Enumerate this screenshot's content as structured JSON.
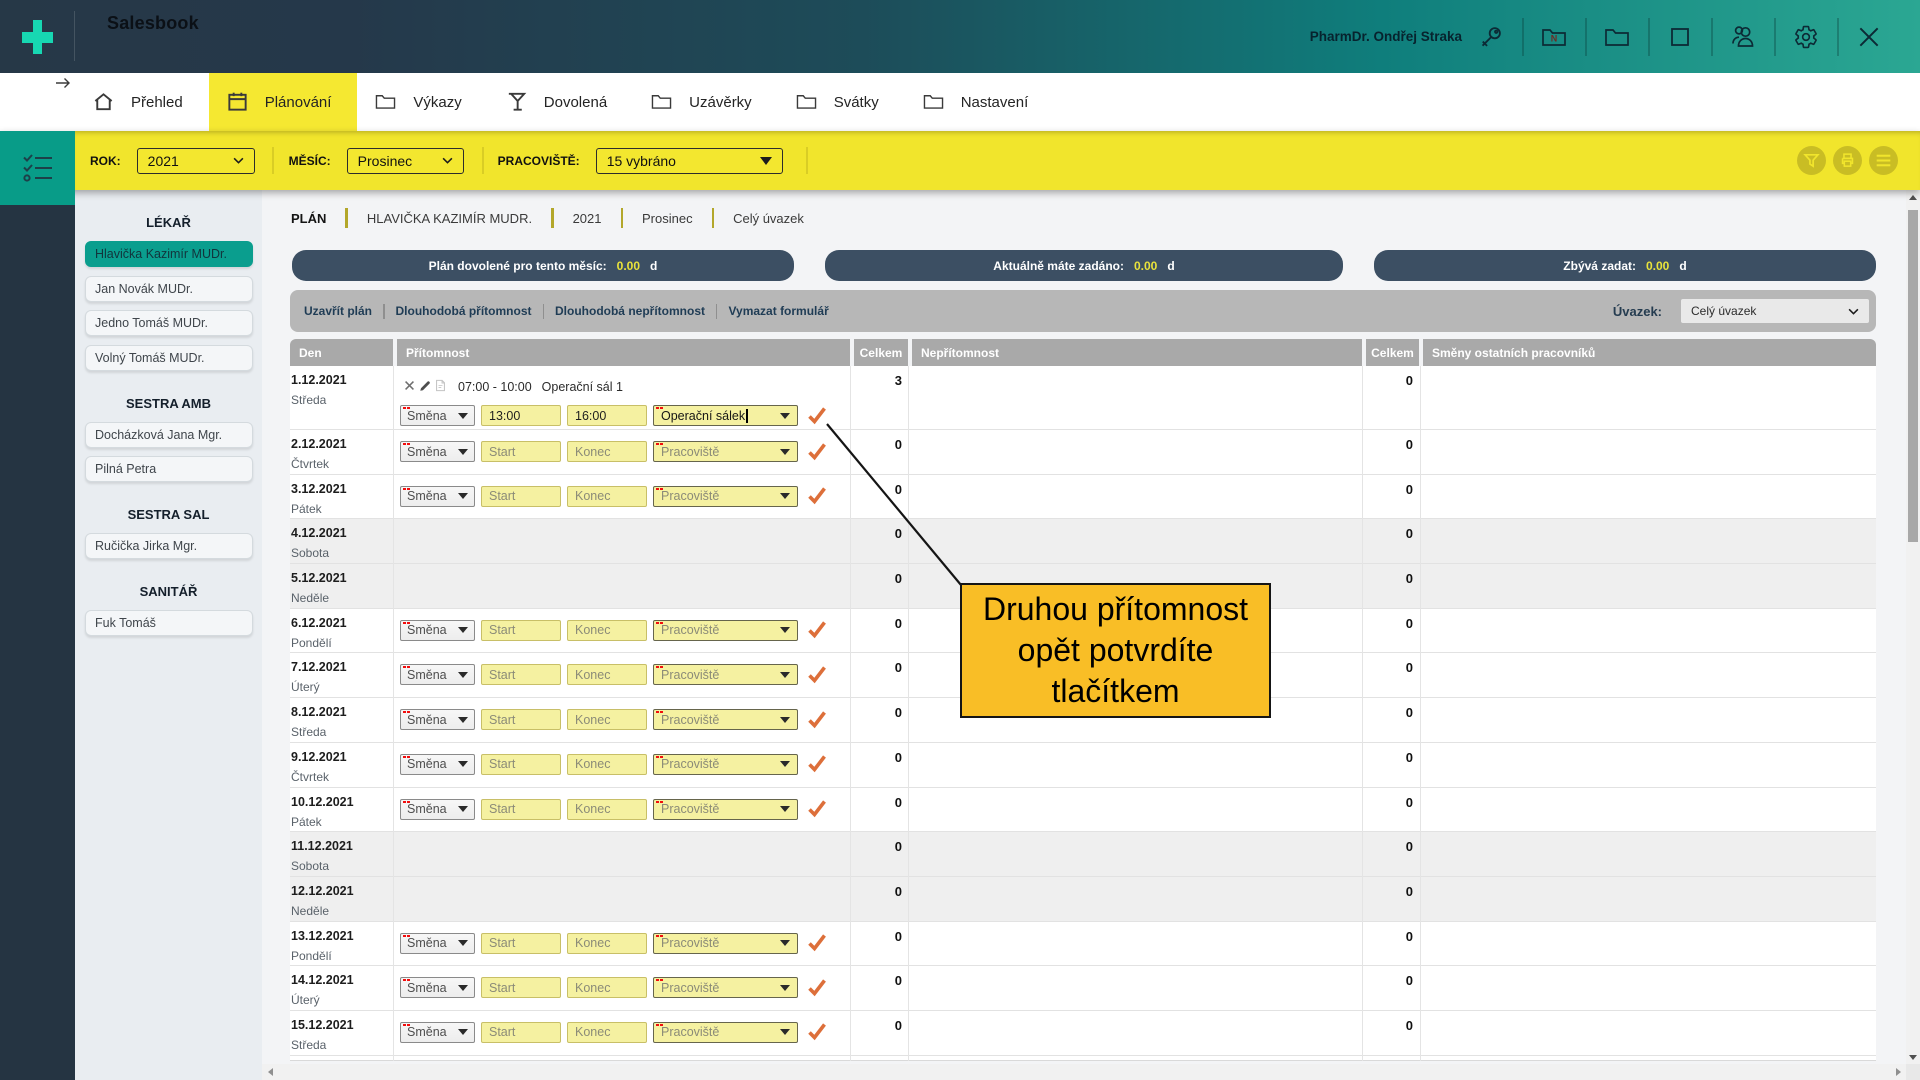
{
  "header": {
    "app_title": "Salesbook",
    "user_name": "PharmDr. Ondřej Straka",
    "icon_buttons": [
      "key",
      "folder-new",
      "folder",
      "stop-square",
      "users",
      "settings-gear",
      "close-x"
    ]
  },
  "nav": {
    "back_arrow": "→",
    "tabs": [
      {
        "label": "Přehled",
        "icon": "home",
        "active": false
      },
      {
        "label": "Plánování",
        "icon": "calendar",
        "active": true
      },
      {
        "label": "Výkazy",
        "icon": "folder",
        "active": false
      },
      {
        "label": "Dovolená",
        "icon": "martini",
        "active": false
      },
      {
        "label": "Uzávěrky",
        "icon": "folder",
        "active": false
      },
      {
        "label": "Svátky",
        "icon": "folder",
        "active": false
      },
      {
        "label": "Nastavení",
        "icon": "folder",
        "active": false
      }
    ]
  },
  "filter_bar": {
    "fields": [
      {
        "label": "ROK:",
        "value": "2021",
        "arrow": "chevron"
      },
      {
        "label": "MĚSÍC:",
        "value": "Prosinec",
        "arrow": "chevron"
      },
      {
        "label": "PRACOVIŠTĚ:",
        "value": "15 vybráno",
        "arrow": "triangle"
      }
    ],
    "action_icons": [
      "filter-funnel",
      "printer",
      "menu-lines"
    ]
  },
  "sidebar": {
    "groups": [
      {
        "title": "LÉKAŘ",
        "people": [
          {
            "name": "Hlavička Kazimír MUDr.",
            "selected": true
          },
          {
            "name": "Jan Novák MUDr.",
            "selected": false
          },
          {
            "name": "Jedno Tomáš MUDr.",
            "selected": false
          },
          {
            "name": "Volný Tomáš MUDr.",
            "selected": false
          }
        ]
      },
      {
        "title": "SESTRA AMB",
        "people": [
          {
            "name": "Docházková Jana Mgr.",
            "selected": false
          },
          {
            "name": "Pilná Petra",
            "selected": false
          }
        ]
      },
      {
        "title": "SESTRA SAL",
        "people": [
          {
            "name": "Ručička Jirka Mgr.",
            "selected": false
          }
        ]
      },
      {
        "title": "SANITÁŘ",
        "people": [
          {
            "name": "Fuk Tomáš",
            "selected": false
          }
        ]
      }
    ]
  },
  "breadcrumb": [
    "PLÁN",
    "HLAVIČKA KAZIMÍR MUDR.",
    "2021",
    "Prosinec",
    "Celý úvazek"
  ],
  "summary_bars": [
    {
      "label": "Plán dovolené pro tento měsíc:",
      "value": "0.00",
      "unit": "d"
    },
    {
      "label": "Aktuálně máte zadáno:",
      "value": "0.00",
      "unit": "d"
    },
    {
      "label": "Zbývá zadat:",
      "value": "0.00",
      "unit": "d"
    }
  ],
  "toolbar": {
    "buttons": [
      "Uzavřít plán",
      "Dlouhodobá přítomnost",
      "Dlouhodobá nepřítomnost",
      "Vymazat formulář"
    ],
    "uvazek_label": "Úvazek:",
    "uvazek_value": "Celý úvazek"
  },
  "table": {
    "columns": [
      "Den",
      "Přítomnost",
      "Celkem",
      "Nepřítomnost",
      "Celkem",
      "Směny ostatních pracovníků"
    ],
    "form_defaults": {
      "shift": "Směna",
      "start": "Start",
      "end": "Konec",
      "workplace": "Pracoviště"
    },
    "rows": [
      {
        "date": "1.12.2021",
        "weekday": "Středa",
        "type": "form",
        "entry": {
          "time": "07:00 - 10:00",
          "place": "Operační sál 1"
        },
        "form_values": {
          "start": "13:00",
          "end": "16:00",
          "workplace": "Operační sálek"
        },
        "celkem_pritomnost": "3",
        "celkem_nepritomnost": "0"
      },
      {
        "date": "2.12.2021",
        "weekday": "Čtvrtek",
        "type": "form",
        "celkem_pritomnost": "0",
        "celkem_nepritomnost": "0"
      },
      {
        "date": "3.12.2021",
        "weekday": "Pátek",
        "type": "form",
        "celkem_pritomnost": "0",
        "celkem_nepritomnost": "0"
      },
      {
        "date": "4.12.2021",
        "weekday": "Sobota",
        "type": "weekend",
        "celkem_pritomnost": "0",
        "celkem_nepritomnost": "0"
      },
      {
        "date": "5.12.2021",
        "weekday": "Neděle",
        "type": "weekend",
        "celkem_pritomnost": "0",
        "celkem_nepritomnost": "0"
      },
      {
        "date": "6.12.2021",
        "weekday": "Pondělí",
        "type": "form",
        "celkem_pritomnost": "0",
        "celkem_nepritomnost": "0"
      },
      {
        "date": "7.12.2021",
        "weekday": "Úterý",
        "type": "form",
        "celkem_pritomnost": "0",
        "celkem_nepritomnost": "0"
      },
      {
        "date": "8.12.2021",
        "weekday": "Středa",
        "type": "form",
        "celkem_pritomnost": "0",
        "celkem_nepritomnost": "0"
      },
      {
        "date": "9.12.2021",
        "weekday": "Čtvrtek",
        "type": "form",
        "celkem_pritomnost": "0",
        "celkem_nepritomnost": "0"
      },
      {
        "date": "10.12.2021",
        "weekday": "Pátek",
        "type": "form",
        "celkem_pritomnost": "0",
        "celkem_nepritomnost": "0"
      },
      {
        "date": "11.12.2021",
        "weekday": "Sobota",
        "type": "weekend",
        "celkem_pritomnost": "0",
        "celkem_nepritomnost": "0"
      },
      {
        "date": "12.12.2021",
        "weekday": "Neděle",
        "type": "weekend",
        "celkem_pritomnost": "0",
        "celkem_nepritomnost": "0"
      },
      {
        "date": "13.12.2021",
        "weekday": "Pondělí",
        "type": "form",
        "celkem_pritomnost": "0",
        "celkem_nepritomnost": "0"
      },
      {
        "date": "14.12.2021",
        "weekday": "Úterý",
        "type": "form",
        "celkem_pritomnost": "0",
        "celkem_nepritomnost": "0"
      },
      {
        "date": "15.12.2021",
        "weekday": "Středa",
        "type": "form",
        "celkem_pritomnost": "0",
        "celkem_nepritomnost": "0"
      }
    ]
  },
  "callout": {
    "lines": [
      "Druhou přítomnost",
      "opět potvrdíte",
      "tlačítkem"
    ]
  },
  "colors": {
    "header_gradient_left": "#263847",
    "header_gradient_right": "#2ba793",
    "accent_yellow": "#f1e52c",
    "teal": "#089c88",
    "summary_bar": "#3c4f63",
    "summary_value": "#e9e33b",
    "callout_fill": "#f9be26",
    "check_orange": "#dd6f3a",
    "input_yellow": "#f6f2a6"
  }
}
